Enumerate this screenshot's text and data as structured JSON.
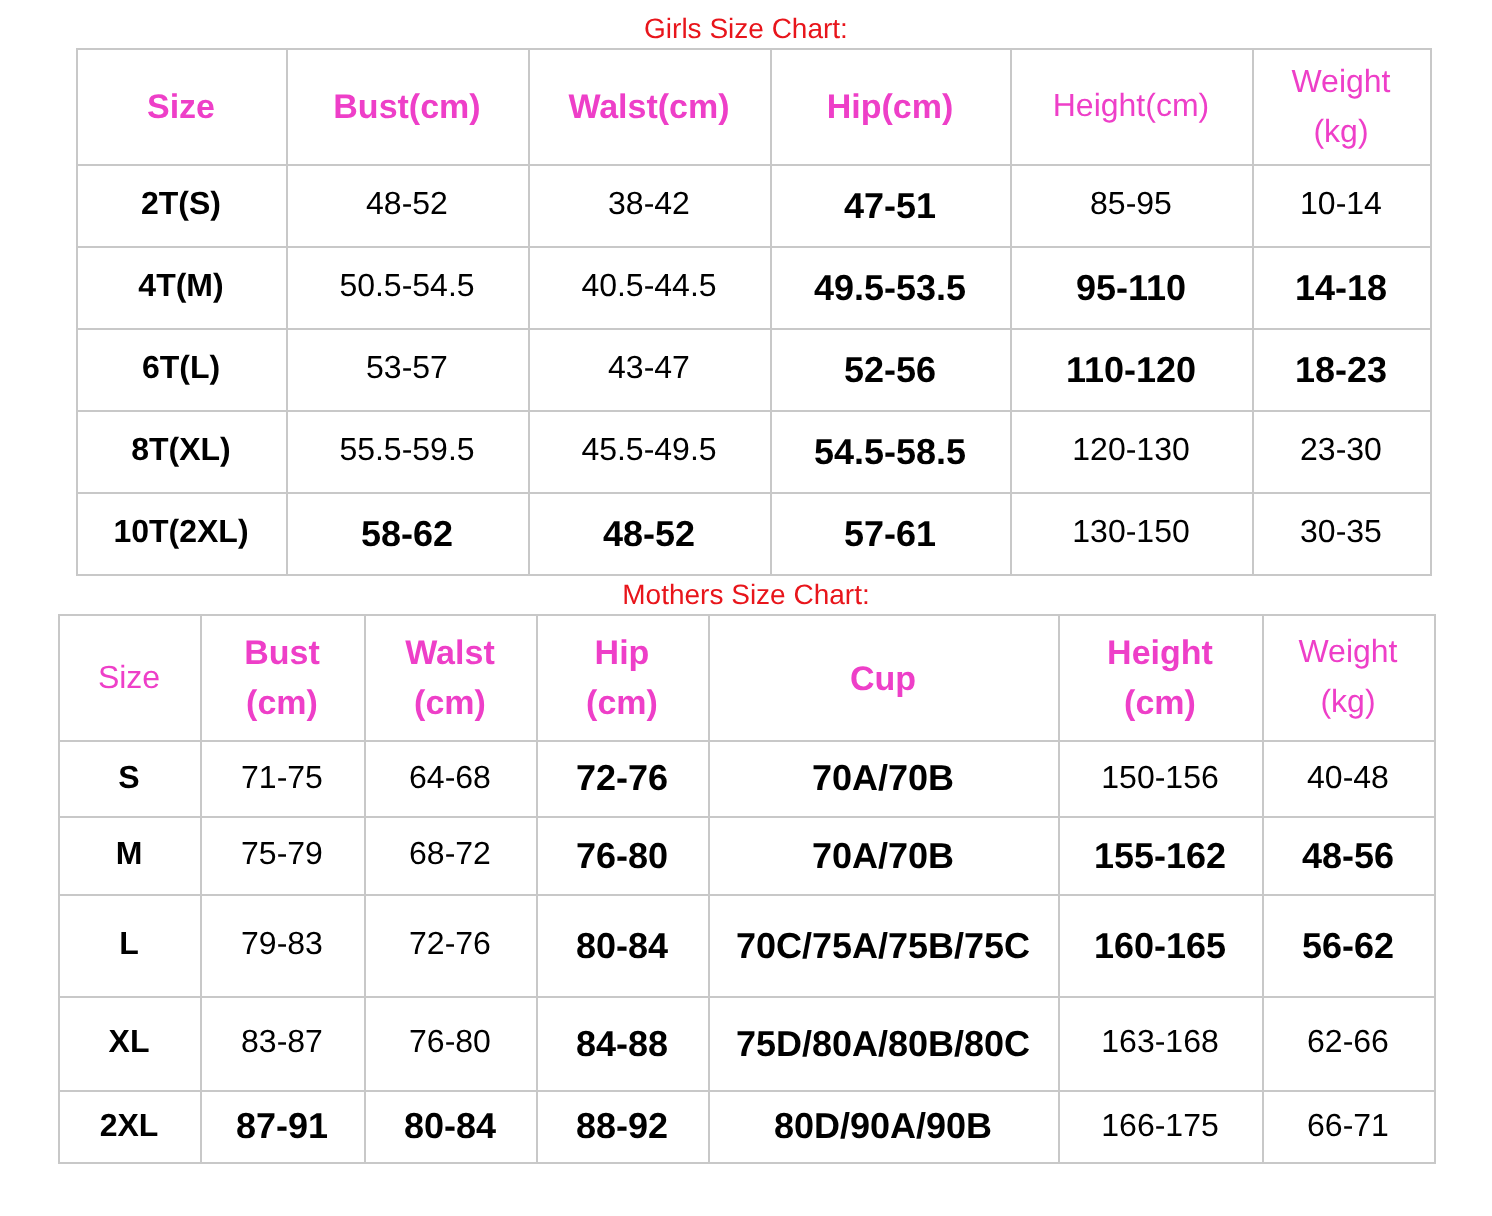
{
  "charts": [
    {
      "title": "Girls Size Chart:",
      "kind": "girls",
      "columns": [
        {
          "text": "Size",
          "bold": true
        },
        {
          "text": "Bust(cm)",
          "bold": true
        },
        {
          "text": "Walst(cm)",
          "bold": true
        },
        {
          "text": "Hip(cm)",
          "bold": true
        },
        {
          "text": "Height(cm)",
          "bold": false
        },
        {
          "text": "Weight\n(kg)",
          "bold": false
        }
      ],
      "rows": [
        [
          {
            "text": "2T(S)",
            "bold": false
          },
          {
            "text": "48-52",
            "bold": false
          },
          {
            "text": "38-42",
            "bold": false
          },
          {
            "text": "47-51",
            "bold": true
          },
          {
            "text": "85-95",
            "bold": false
          },
          {
            "text": "10-14",
            "bold": false
          }
        ],
        [
          {
            "text": "4T(M)",
            "bold": false
          },
          {
            "text": "50.5-54.5",
            "bold": false
          },
          {
            "text": "40.5-44.5",
            "bold": false
          },
          {
            "text": "49.5-53.5",
            "bold": true
          },
          {
            "text": "95-110",
            "bold": true
          },
          {
            "text": "14-18",
            "bold": true
          }
        ],
        [
          {
            "text": "6T(L)",
            "bold": false
          },
          {
            "text": "53-57",
            "bold": false
          },
          {
            "text": "43-47",
            "bold": false
          },
          {
            "text": "52-56",
            "bold": true
          },
          {
            "text": "110-120",
            "bold": true
          },
          {
            "text": "18-23",
            "bold": true
          }
        ],
        [
          {
            "text": "8T(XL)",
            "bold": false
          },
          {
            "text": "55.5-59.5",
            "bold": false
          },
          {
            "text": "45.5-49.5",
            "bold": false
          },
          {
            "text": "54.5-58.5",
            "bold": true
          },
          {
            "text": "120-130",
            "bold": false
          },
          {
            "text": "23-30",
            "bold": false
          }
        ],
        [
          {
            "text": "10T(2XL)",
            "bold": false
          },
          {
            "text": "58-62",
            "bold": true
          },
          {
            "text": "48-52",
            "bold": true
          },
          {
            "text": "57-61",
            "bold": true
          },
          {
            "text": "130-150",
            "bold": false
          },
          {
            "text": "30-35",
            "bold": false
          }
        ]
      ]
    },
    {
      "title": "Mothers Size Chart:",
      "kind": "mothers",
      "columns": [
        {
          "text": "Size",
          "bold": false
        },
        {
          "text": "Bust\n(cm)",
          "bold": true
        },
        {
          "text": "Walst\n(cm)",
          "bold": true
        },
        {
          "text": "Hip\n(cm)",
          "bold": true
        },
        {
          "text": "Cup",
          "bold": true
        },
        {
          "text": "Height\n(cm)",
          "bold": true
        },
        {
          "text": "Weight\n(kg)",
          "bold": false
        }
      ],
      "rows": [
        [
          {
            "text": "S",
            "bold": false
          },
          {
            "text": "71-75",
            "bold": false
          },
          {
            "text": "64-68",
            "bold": false
          },
          {
            "text": "72-76",
            "bold": true
          },
          {
            "text": "70A/70B",
            "bold": true
          },
          {
            "text": "150-156",
            "bold": false
          },
          {
            "text": "40-48",
            "bold": false
          }
        ],
        [
          {
            "text": "M",
            "bold": false
          },
          {
            "text": "75-79",
            "bold": false
          },
          {
            "text": "68-72",
            "bold": false
          },
          {
            "text": "76-80",
            "bold": true
          },
          {
            "text": "70A/70B",
            "bold": true
          },
          {
            "text": "155-162",
            "bold": true
          },
          {
            "text": "48-56",
            "bold": true
          }
        ],
        [
          {
            "text": "L",
            "bold": false
          },
          {
            "text": "79-83",
            "bold": false
          },
          {
            "text": "72-76",
            "bold": false
          },
          {
            "text": "80-84",
            "bold": true
          },
          {
            "text": "70C/75A/75B/75C",
            "bold": true
          },
          {
            "text": "160-165",
            "bold": true
          },
          {
            "text": "56-62",
            "bold": true
          }
        ],
        [
          {
            "text": "XL",
            "bold": false
          },
          {
            "text": "83-87",
            "bold": false
          },
          {
            "text": "76-80",
            "bold": false
          },
          {
            "text": "84-88",
            "bold": true
          },
          {
            "text": "75D/80A/80B/80C",
            "bold": true
          },
          {
            "text": "163-168",
            "bold": false
          },
          {
            "text": "62-66",
            "bold": false
          }
        ],
        [
          {
            "text": "2XL",
            "bold": false
          },
          {
            "text": "87-91",
            "bold": true
          },
          {
            "text": "80-84",
            "bold": true
          },
          {
            "text": "88-92",
            "bold": true
          },
          {
            "text": "80D/90A/90B",
            "bold": true
          },
          {
            "text": "166-175",
            "bold": false
          },
          {
            "text": "66-71",
            "bold": false
          }
        ]
      ]
    }
  ]
}
